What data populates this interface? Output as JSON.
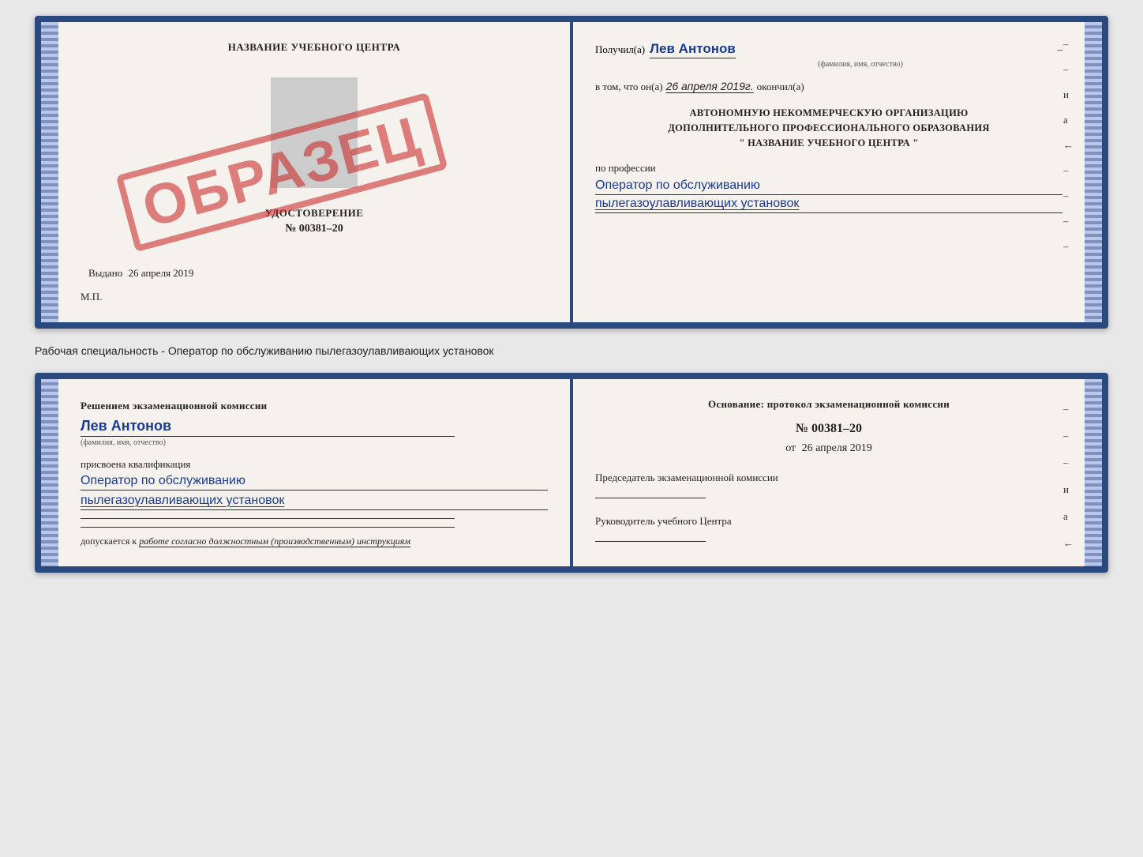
{
  "top_left": {
    "center_title": "НАЗВАНИЕ УЧЕБНОГО ЦЕНТРА",
    "stamp_text": "ОБРАЗЕЦ",
    "udostoverenie_title": "УДОСТОВЕРЕНИЕ",
    "number": "№ 00381–20",
    "vydano_prefix": "Выдано",
    "vydano_date": "26 апреля 2019",
    "mp_label": "М.П."
  },
  "top_right": {
    "poluchil_label": "Получил(а)",
    "poluchil_name": "Лев Антонов",
    "fio_label": "(фамилия, имя, отчество)",
    "dash": "–",
    "vtom_prefix": "в том, что он(а)",
    "vtom_date": "26 апреля 2019г.",
    "vtom_suffix": "окончил(а)",
    "org_line1": "АВТОНОМНУЮ НЕКОММЕРЧЕСКУЮ ОРГАНИЗАЦИЮ",
    "org_line2": "ДОПОЛНИТЕЛЬНОГО ПРОФЕССИОНАЛЬНОГО ОБРАЗОВАНИЯ",
    "org_line3": "\"  НАЗВАНИЕ УЧЕБНОГО ЦЕНТРА  \"",
    "profession_label": "по профессии",
    "profession_line1": "Оператор по обслуживанию",
    "profession_line2": "пылегазоулавливающих установок"
  },
  "middle": {
    "text": "Рабочая специальность - Оператор по обслуживанию пылегазоулавливающих установок"
  },
  "bottom_left": {
    "resheniem_text": "Решением экзаменационной комиссии",
    "person_name": "Лев Антонов",
    "fio_label": "(фамилия, имя, отчество)",
    "prisvoena_label": "присвоена квалификация",
    "kvalif_line1": "Оператор по обслуживанию",
    "kvalif_line2": "пылегазоулавливающих установок",
    "dopuskaetsya_prefix": "допускается к",
    "dopuskaetsya_italic": "работе согласно должностным (производственным) инструкциям"
  },
  "bottom_right": {
    "osnovanie_text": "Основание: протокол экзаменационной комиссии",
    "protocol_number": "№  00381–20",
    "ot_prefix": "от",
    "protocol_date": "26 апреля 2019",
    "predsedatel_title": "Председатель экзаменационной комиссии",
    "rukovoditel_title": "Руководитель учебного Центра"
  }
}
